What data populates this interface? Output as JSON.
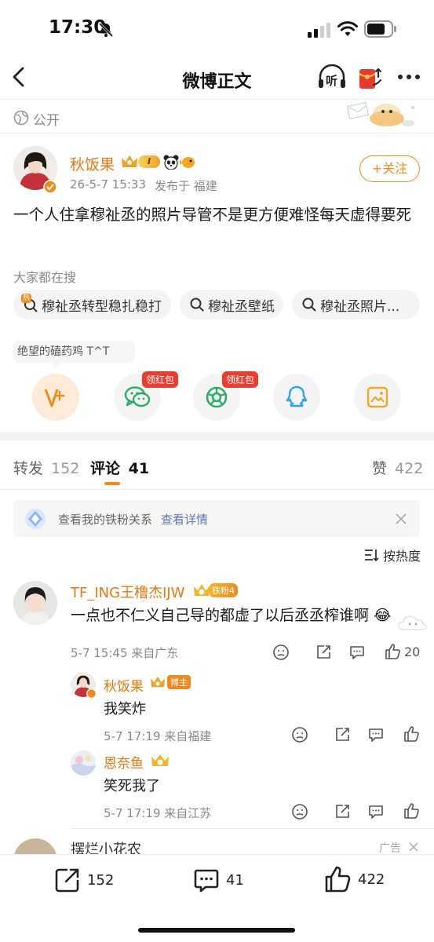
{
  "status_bar": {
    "time": "17:30"
  },
  "header": {
    "title": "微博正文",
    "listen_label": "听"
  },
  "visibility": {
    "label": "公开"
  },
  "post": {
    "author": "秋饭果",
    "meta": "26-5-7 15:33",
    "location": "发布于 福建",
    "follow_label": "+关注",
    "text": "一个人住拿穆祉丞的照片导管不是更方便难怪每天虚得要死",
    "level_badge": "I"
  },
  "search": {
    "title": "大家都在搜",
    "chips": [
      "穆祉丞转型稳扎稳打",
      "穆祉丞壁纸",
      "穆祉丞照片..."
    ],
    "hot_badge": "热"
  },
  "share": {
    "username": "绝望的磕药鸡 T^T",
    "items": [
      {
        "name": "weibo-share",
        "badge": ""
      },
      {
        "name": "wechat-share",
        "badge": "领红包"
      },
      {
        "name": "moments-share",
        "badge": "领红包"
      },
      {
        "name": "qq-share",
        "badge": ""
      },
      {
        "name": "save-image-share",
        "badge": ""
      }
    ]
  },
  "tabs": {
    "repost_label": "转发",
    "repost_count": "152",
    "comment_label": "评论",
    "comment_count": "41",
    "like_label": "赞",
    "like_count": "422"
  },
  "fan_banner": {
    "text": "查看我的铁粉关系",
    "link": "查看详情"
  },
  "sort": {
    "label": "按热度"
  },
  "comments": [
    {
      "name": "TF_ING王橹杰IJW",
      "badge": "铁粉4",
      "text": "一点也不仁义自己导的都虚了以后丞丞榨谁啊",
      "emoji": "😂",
      "meta": "5-7 15:45 来自广东",
      "likes": "20"
    }
  ],
  "replies": [
    {
      "name": "秋饭果",
      "badge": "博主",
      "text": "我笑炸",
      "meta": "5-7 17:19 来自福建"
    },
    {
      "name": "恩奈鱼",
      "badge": "",
      "text": "笑死我了",
      "meta": "5-7 17:19 来自江苏"
    }
  ],
  "ad": {
    "name": "摆烂小花农_",
    "label": "广告"
  },
  "bottom_bar": {
    "repost": "152",
    "comment": "41",
    "like": "422"
  },
  "colors": {
    "accent": "#f08a1c",
    "link": "#5b7bbf",
    "red": "#ec3b2f"
  }
}
